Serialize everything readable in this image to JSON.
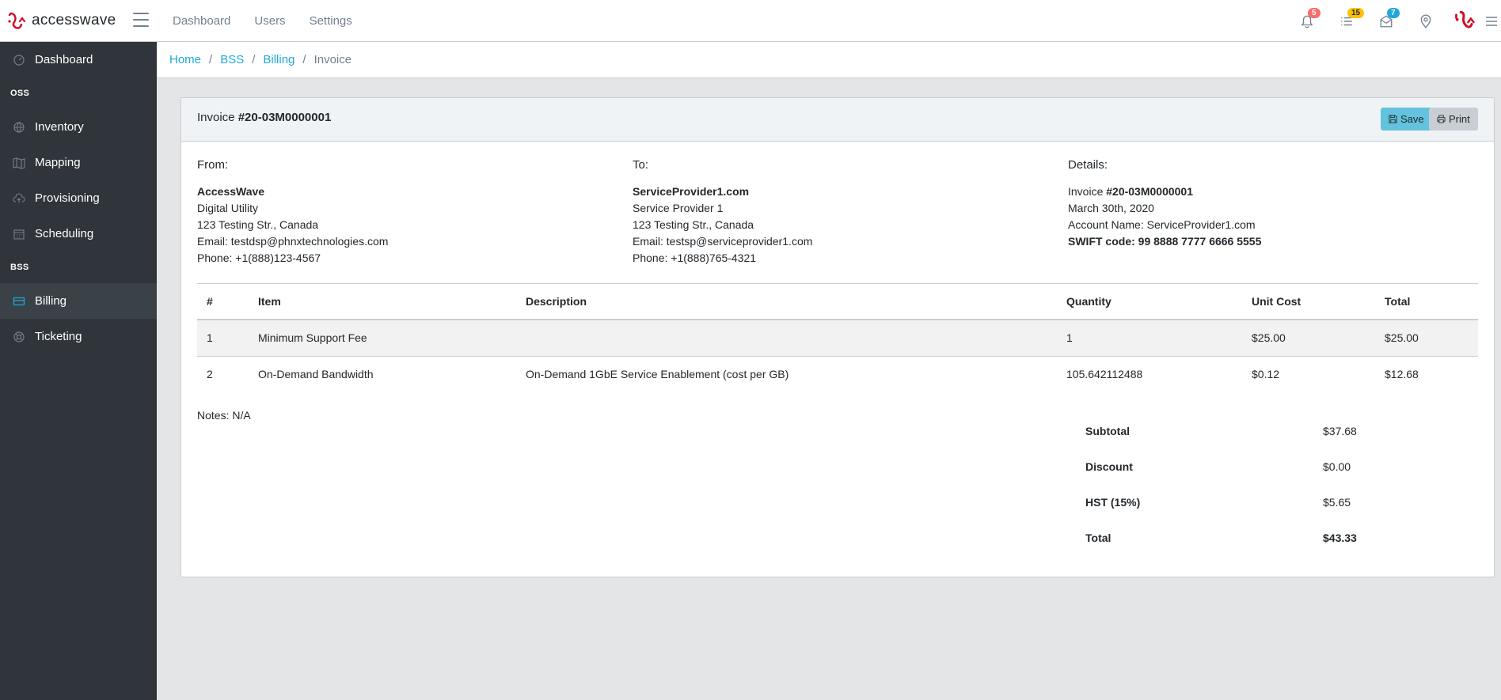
{
  "brand": {
    "name": "accesswave"
  },
  "topnav": {
    "items": [
      "Dashboard",
      "Users",
      "Settings"
    ]
  },
  "header_icons": {
    "notifications": {
      "icon": "bell-icon",
      "badge": "5"
    },
    "tasks": {
      "icon": "list-icon",
      "badge": "15"
    },
    "messages": {
      "icon": "envelope-icon",
      "badge": "7"
    },
    "location": {
      "icon": "location-pin-icon"
    }
  },
  "sidebar": {
    "dashboard": "Dashboard",
    "oss_title": "OSS",
    "oss_items": [
      "Inventory",
      "Mapping",
      "Provisioning",
      "Scheduling"
    ],
    "bss_title": "BSS",
    "bss_items": [
      "Billing",
      "Ticketing"
    ],
    "active": "Billing"
  },
  "breadcrumb": {
    "items": [
      "Home",
      "BSS",
      "Billing"
    ],
    "current": "Invoice"
  },
  "invoice": {
    "title_prefix": "Invoice",
    "number": "#20-03M0000001",
    "save_label": "Save",
    "print_label": "Print",
    "from": {
      "heading": "From:",
      "name": "AccessWave",
      "line1": "Digital Utility",
      "line2": "123 Testing Str., Canada",
      "email": "Email: testdsp@phnxtechnologies.com",
      "phone": "Phone: +1(888)123-4567"
    },
    "to": {
      "heading": "To:",
      "name": "ServiceProvider1.com",
      "line1": "Service Provider 1",
      "line2": "123 Testing Str., Canada",
      "email": "Email: testsp@serviceprovider1.com",
      "phone": "Phone: +1(888)765-4321"
    },
    "details": {
      "heading": "Details:",
      "invoice_label": "Invoice",
      "invoice_number": "#20-03M0000001",
      "date": "March 30th, 2020",
      "account": "Account Name: ServiceProvider1.com",
      "swift": "SWIFT code: 99 8888 7777 6666 5555"
    },
    "columns": [
      "#",
      "Item",
      "Description",
      "Quantity",
      "Unit Cost",
      "Total"
    ],
    "rows": [
      [
        "1",
        "Minimum Support Fee",
        "",
        "1",
        "$25.00",
        "$25.00"
      ],
      [
        "2",
        "On-Demand Bandwidth",
        "On-Demand 1GbE Service Enablement (cost per GB)",
        "105.642112488",
        "$0.12",
        "$12.68"
      ]
    ],
    "notes": "Notes: N/A",
    "totals": {
      "subtotal_label": "Subtotal",
      "subtotal": "$37.68",
      "discount_label": "Discount",
      "discount": "$0.00",
      "tax_label": "HST (15%)",
      "tax": "$5.65",
      "total_label": "Total",
      "total": "$43.33"
    }
  }
}
